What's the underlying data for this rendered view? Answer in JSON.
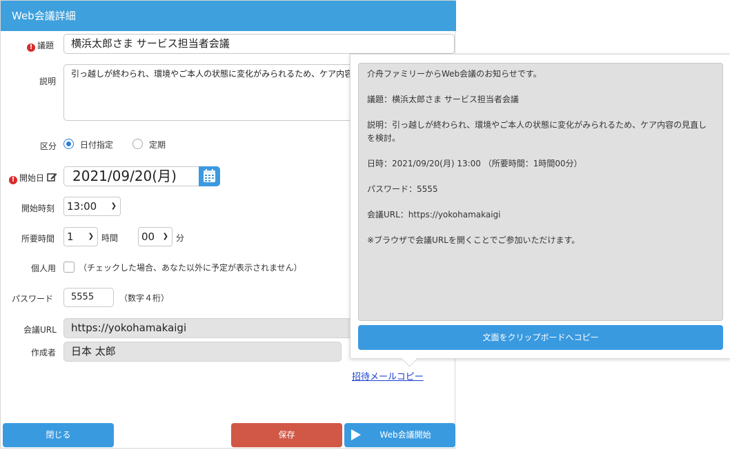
{
  "header": {
    "title": "Web会議詳細"
  },
  "form": {
    "subject": {
      "label": "議題",
      "value": "横浜太郎さま サービス担当者会議"
    },
    "description": {
      "label": "説明",
      "value": "引っ越しが終わられ、環境やご本人の状態に変化がみられるため、ケア内容の見直しを検討。"
    },
    "category": {
      "label": "区分",
      "options": [
        "日付指定",
        "定期"
      ],
      "selected": "日付指定"
    },
    "start_date": {
      "label": "開始日",
      "value": "2021/09/20(月)"
    },
    "start_time": {
      "label": "開始時刻",
      "value": "13:00"
    },
    "duration": {
      "label": "所要時間",
      "hours": "1",
      "hours_unit": "時間",
      "minutes": "00",
      "minutes_unit": "分"
    },
    "personal": {
      "label": "個人用",
      "note": "（チェックした場合、あなた以外に予定が表示されません）",
      "checked": false
    },
    "password": {
      "label": "パスワード",
      "value": "5555",
      "hint": "（数字４桁）"
    },
    "meeting_url": {
      "label": "会議URL",
      "value": "https://yokohamakaigi"
    },
    "creator": {
      "label": "作成者",
      "value": "日本 太郎"
    }
  },
  "invite_link": "招待メールコピー",
  "buttons": {
    "close": "閉じる",
    "save": "保存",
    "start": "Web会議開始"
  },
  "popup": {
    "lines": [
      "介舟ファミリーからWeb会議のお知らせです。",
      "議題：横浜太郎さま サービス担当者会議",
      "説明：引っ越しが終わられ、環境やご本人の状態に変化がみられるため、ケア内容の見直しを検討。",
      "日時：2021/09/20(月) 13:00 （所要時間：1時間00分）",
      "パスワード：5555",
      "会議URL：https://yokohamakaigi",
      "※ブラウザで会議URLを開くことでご参加いただけます。"
    ],
    "copy_button": "文面をクリップボードへコピー"
  },
  "colors": {
    "header": "#3ea0dd",
    "primary": "#3a9ae0",
    "danger": "#d15846",
    "required": "#d92b2b",
    "link": "#1a3fd0"
  }
}
